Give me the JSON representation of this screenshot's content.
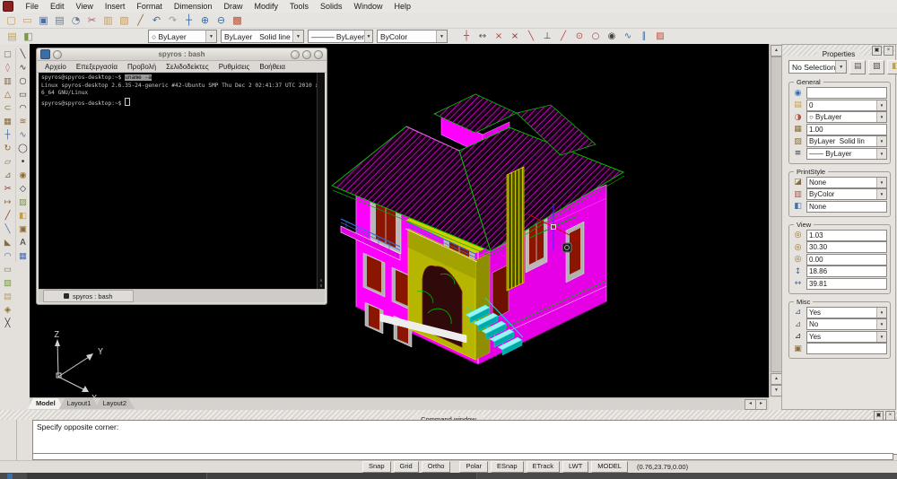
{
  "menubar": {
    "items": [
      "File",
      "Edit",
      "View",
      "Insert",
      "Format",
      "Dimension",
      "Draw",
      "Modify",
      "Tools",
      "Solids",
      "Window",
      "Help"
    ]
  },
  "toolbar_main": {
    "icons": [
      {
        "name": "new-file-icon",
        "glyph": "▢",
        "color": "#c79a55"
      },
      {
        "name": "open-file-icon",
        "glyph": "▭",
        "color": "#c79a55"
      },
      {
        "name": "save-icon",
        "glyph": "▣",
        "color": "#4a6fa5"
      },
      {
        "name": "print-icon",
        "glyph": "▤",
        "color": "#6b7b8c"
      },
      {
        "name": "print-preview-icon",
        "glyph": "◔",
        "color": "#6b7b8c"
      },
      {
        "name": "cut-icon",
        "glyph": "✂",
        "color": "#b05555"
      },
      {
        "name": "copy-icon",
        "glyph": "▥",
        "color": "#c79a55"
      },
      {
        "name": "paste-icon",
        "glyph": "▧",
        "color": "#c79a55"
      },
      {
        "name": "match-properties-icon",
        "glyph": "╱",
        "color": "#8a6d3b"
      },
      {
        "name": "undo-icon",
        "glyph": "↶",
        "color": "#3a6ea5"
      },
      {
        "name": "redo-icon",
        "glyph": "↷",
        "color": "#9a9a9a"
      },
      {
        "name": "pan-icon",
        "glyph": "┼",
        "color": "#3a6ea5"
      },
      {
        "name": "zoom-in-icon",
        "glyph": "⊕",
        "color": "#3a6ea5"
      },
      {
        "name": "zoom-out-icon",
        "glyph": "⊖",
        "color": "#3a6ea5"
      },
      {
        "name": "layer-manager-icon",
        "glyph": "▩",
        "color": "#b0503a"
      }
    ]
  },
  "toolbar_entity": {
    "lead_icons": [
      {
        "name": "layers-dialog-icon",
        "glyph": "▤",
        "color": "#c7a040"
      },
      {
        "name": "layer-previous-icon",
        "glyph": "◧",
        "color": "#7a9a4a"
      }
    ],
    "color": {
      "display": "○ ByLayer"
    },
    "linetype": {
      "display": "ByLayer",
      "display2": "Solid line"
    },
    "lineweight": {
      "display": "——— ByLayer"
    },
    "plot_style": {
      "display": "ByColor"
    },
    "snap_icons": [
      {
        "name": "snap-tracking-icon",
        "glyph": "┼",
        "color": "#b04040"
      },
      {
        "name": "snap-from-icon",
        "glyph": "↔",
        "color": "#555555"
      },
      {
        "name": "snap-endpoint-icon",
        "glyph": "×",
        "color": "#b04040"
      },
      {
        "name": "snap-intersection-icon",
        "glyph": "×",
        "color": "#8a3030"
      },
      {
        "name": "snap-midpoint-icon",
        "glyph": "╲",
        "color": "#b04040"
      },
      {
        "name": "snap-perpendicular-icon",
        "glyph": "⊥",
        "color": "#444444"
      },
      {
        "name": "snap-tangent-icon",
        "glyph": "╱",
        "color": "#b04040"
      },
      {
        "name": "snap-center-icon",
        "glyph": "⊙",
        "color": "#b04040"
      },
      {
        "name": "snap-quadrant-icon",
        "glyph": "○",
        "color": "#b04040"
      },
      {
        "name": "snap-node-icon",
        "glyph": "◉",
        "color": "#444444"
      },
      {
        "name": "snap-nearest-icon",
        "glyph": "∿",
        "color": "#3a6ea5"
      },
      {
        "name": "snap-parallel-icon",
        "glyph": "∥",
        "color": "#3a6ea5"
      },
      {
        "name": "snap-settings-icon",
        "glyph": "▨",
        "color": "#b0503a"
      }
    ]
  },
  "left_toolbar": {
    "modify": [
      {
        "name": "select-icon",
        "glyph": "▢",
        "color": "#8a6d3b"
      },
      {
        "name": "erase-icon",
        "glyph": "◊",
        "color": "#c06080"
      },
      {
        "name": "copy-entities-icon",
        "glyph": "▥",
        "color": "#8a6d3b"
      },
      {
        "name": "mirror-icon",
        "glyph": "△",
        "color": "#8a6d3b"
      },
      {
        "name": "offset-icon",
        "glyph": "⊂",
        "color": "#8a6d3b"
      },
      {
        "name": "array-icon",
        "glyph": "▦",
        "color": "#8a6d3b"
      },
      {
        "name": "move-icon",
        "glyph": "┼",
        "color": "#4a6fa5"
      },
      {
        "name": "rotate-icon",
        "glyph": "↻",
        "color": "#8a6d3b"
      },
      {
        "name": "scale-icon",
        "glyph": "▱",
        "color": "#8a6d3b"
      },
      {
        "name": "stretch-icon",
        "glyph": "⊿",
        "color": "#8a6d3b"
      },
      {
        "name": "trim-icon",
        "glyph": "✂",
        "color": "#8a3030"
      },
      {
        "name": "extend-icon",
        "glyph": "↦",
        "color": "#8a6d3b"
      },
      {
        "name": "break-icon",
        "glyph": "╱",
        "color": "#8a3030"
      },
      {
        "name": "join-icon",
        "glyph": "╲",
        "color": "#4a6fa5"
      },
      {
        "name": "chamfer-icon",
        "glyph": "◣",
        "color": "#8a6d3b"
      },
      {
        "name": "fillet-icon",
        "glyph": "◠",
        "color": "#4a6fa5"
      },
      {
        "name": "region-icon",
        "glyph": "▭",
        "color": "#8a6d3b"
      },
      {
        "name": "hatch-edit-icon",
        "glyph": "▨",
        "color": "#7a9a4a"
      },
      {
        "name": "boundary-icon",
        "glyph": "▤",
        "color": "#c7a040"
      },
      {
        "name": "solids-edit-icon",
        "glyph": "◈",
        "color": "#8a6d3b"
      },
      {
        "name": "explode-icon",
        "glyph": "╳",
        "color": "#333333"
      }
    ],
    "draw": [
      {
        "name": "line-icon",
        "glyph": "╲",
        "color": "#333333"
      },
      {
        "name": "polyline-icon",
        "glyph": "∿",
        "color": "#333333"
      },
      {
        "name": "circle-icon",
        "glyph": "○",
        "color": "#333333"
      },
      {
        "name": "rectangle-icon",
        "glyph": "▭",
        "color": "#333333"
      },
      {
        "name": "arc-icon",
        "glyph": "◠",
        "color": "#333333"
      },
      {
        "name": "revcloud-icon",
        "glyph": "≋",
        "color": "#8a6d3b"
      },
      {
        "name": "spline-icon",
        "glyph": "∿",
        "color": "#4a6fa5"
      },
      {
        "name": "ellipse-icon",
        "glyph": "◯",
        "color": "#333333"
      },
      {
        "name": "point-icon",
        "glyph": "•",
        "color": "#333333"
      },
      {
        "name": "donut-icon",
        "glyph": "◉",
        "color": "#8a6d3b"
      },
      {
        "name": "polygon-icon",
        "glyph": "◇",
        "color": "#333333"
      },
      {
        "name": "hatch-icon",
        "glyph": "▨",
        "color": "#7a9a4a"
      },
      {
        "name": "gradient-icon",
        "glyph": "◧",
        "color": "#c7a040"
      },
      {
        "name": "region-draw-icon",
        "glyph": "▣",
        "color": "#8a6d3b"
      },
      {
        "name": "mtext-icon",
        "glyph": "A",
        "color": "#333333"
      },
      {
        "name": "table-icon",
        "glyph": "▦",
        "color": "#4a6fa5"
      }
    ]
  },
  "terminal": {
    "title": "spyros : bash",
    "menu": [
      "Αρχείο",
      "Επεξεργασία",
      "Προβολή",
      "Σελιδοδείκτες",
      "Ρυθμίσεις",
      "Βοήθεια"
    ],
    "lines": {
      "prompt1": "spyros@spyros-desktop:~$ ",
      "command1": "uname -a",
      "output1": "Linux spyros-desktop 2.6.35-24-generic #42-Ubuntu SMP Thu Dec 2 02:41:37 UTC 2010 x8",
      "output2": "6_64 GNU/Linux",
      "prompt2": "spyros@spyros-desktop:~$ "
    },
    "scroll": {
      "up": "∧",
      "down": "∨"
    },
    "tab": "spyros : bash"
  },
  "canvas": {
    "ucs": {
      "x_label": "X",
      "y_label": "Y",
      "z_label": "Z"
    },
    "model_colors": {
      "walls": "#ff00ff",
      "roof_hatch": "#ff00ff",
      "roof_edges": "#00c000",
      "portico": "#b6b600",
      "chimney": "#c8c800",
      "stairs": "#00ffff",
      "window_glass": "#8b1500",
      "shutters": "#b8b8b8",
      "balcony_rail": "#3a6ad0",
      "slab": "#ededed"
    }
  },
  "properties_panel": {
    "title": "Properties",
    "pin_icon": "▣",
    "close_icon": "×",
    "selection": "No Selection",
    "buttons": [
      {
        "name": "quick-select-icon",
        "glyph": "▤",
        "color": "#555555"
      },
      {
        "name": "select-entities-icon",
        "glyph": "▧",
        "color": "#555555"
      },
      {
        "name": "toggle-value-icon",
        "glyph": "◧",
        "color": "#c7a040"
      }
    ],
    "groups": [
      {
        "label": "General",
        "rows": [
          {
            "name": "entity-name-row",
            "icon": "globe-icon",
            "glyph": "◉",
            "color": "#3a6ea5",
            "value": "",
            "control": "input"
          },
          {
            "name": "layer-row",
            "icon": "layer-folder-icon",
            "glyph": "▤",
            "color": "#c7a040",
            "value": "0",
            "control": "select"
          },
          {
            "name": "color-row",
            "icon": "color-wheel-icon",
            "glyph": "◑",
            "color": "#b0503a",
            "value": "○ ByLayer",
            "control": "select"
          },
          {
            "name": "linetype-scale-row",
            "icon": "linetype-scale-icon",
            "glyph": "▦",
            "color": "#8a6d3b",
            "value": "1.00",
            "control": "input"
          },
          {
            "name": "linetype-row",
            "icon": "linetype-icon",
            "glyph": "▨",
            "color": "#8a6d3b",
            "value": "ByLayer  Solid lin",
            "control": "select"
          },
          {
            "name": "lineweight-row",
            "icon": "lineweight-icon",
            "glyph": "≡",
            "color": "#333333",
            "value": "—— ByLayer",
            "control": "select"
          }
        ]
      },
      {
        "label": "PrintStyle",
        "rows": [
          {
            "name": "print-style-row",
            "icon": "print-brush-icon",
            "glyph": "◪",
            "color": "#8a6d3b",
            "value": "None",
            "control": "select"
          },
          {
            "name": "print-color-row",
            "icon": "color-bars-icon",
            "glyph": "▥",
            "color": "#b0503a",
            "value": "ByColor",
            "control": "select"
          },
          {
            "name": "print-table-row",
            "icon": "print-table-icon",
            "glyph": "◧",
            "color": "#4a6fa5",
            "value": "None",
            "control": "input"
          }
        ]
      },
      {
        "label": "View",
        "rows": [
          {
            "name": "camera-x-row",
            "icon": "camera-icon",
            "glyph": "◎",
            "color": "#8a6d3b",
            "value": "1.03",
            "control": "input"
          },
          {
            "name": "camera-y-row",
            "icon": "camera-icon",
            "glyph": "◎",
            "color": "#8a6d3b",
            "value": "30.30",
            "control": "input"
          },
          {
            "name": "camera-z-row",
            "icon": "camera-icon",
            "glyph": "◎",
            "color": "#8a6d3b",
            "value": "0.00",
            "control": "input"
          },
          {
            "name": "view-height-row",
            "icon": "view-height-icon",
            "glyph": "↕",
            "color": "#3a6ea5",
            "value": "18.86",
            "control": "input"
          },
          {
            "name": "view-width-row",
            "icon": "view-width-icon",
            "glyph": "↔",
            "color": "#3a6ea5",
            "value": "39.81",
            "control": "input"
          }
        ]
      },
      {
        "label": "Misc",
        "rows": [
          {
            "name": "ucs-icon-on-row",
            "icon": "ucs-axes-icon",
            "glyph": "⊿",
            "color": "#3a6ea5",
            "value": "Yes",
            "control": "select"
          },
          {
            "name": "ucs-icon-origin-row",
            "icon": "ucs-origin-icon",
            "glyph": "⊿",
            "color": "#8a6d3b",
            "value": "No",
            "control": "select"
          },
          {
            "name": "ucs-per-viewport-row",
            "icon": "ucs-viewport-icon",
            "glyph": "⊿",
            "color": "#333333",
            "value": "Yes",
            "control": "select"
          },
          {
            "name": "background-row",
            "icon": "background-image-icon",
            "glyph": "▣",
            "color": "#8a6d3b",
            "value": "",
            "control": "input"
          }
        ]
      }
    ]
  },
  "layout_tabs": {
    "items": [
      {
        "name": "model-tab",
        "label": "Model",
        "active": true
      },
      {
        "name": "layout1-tab",
        "label": "Layout1",
        "active": false
      },
      {
        "name": "layout2-tab",
        "label": "Layout2",
        "active": false
      }
    ]
  },
  "scrollbars": {
    "up": "▲",
    "down": "▼",
    "left": "◂",
    "right": "▸"
  },
  "command_window": {
    "title": "Command window",
    "pin_icon": "▣",
    "close_icon": "×",
    "prompt": "Specify opposite corner:",
    "input": ""
  },
  "statusbar": {
    "buttons": [
      {
        "name": "snap-toggle",
        "label": "Snap"
      },
      {
        "name": "grid-toggle",
        "label": "Grid"
      },
      {
        "name": "ortho-toggle",
        "label": "Ortho"
      },
      {
        "name": "polar-toggle",
        "label": "Polar"
      },
      {
        "name": "esnap-toggle",
        "label": "ESnap"
      },
      {
        "name": "etrack-toggle",
        "label": "ETrack"
      },
      {
        "name": "lwt-toggle",
        "label": "LWT"
      },
      {
        "name": "model-space-toggle",
        "label": "MODEL"
      }
    ],
    "coordinates": "(0.76,23.79,0.00)"
  }
}
